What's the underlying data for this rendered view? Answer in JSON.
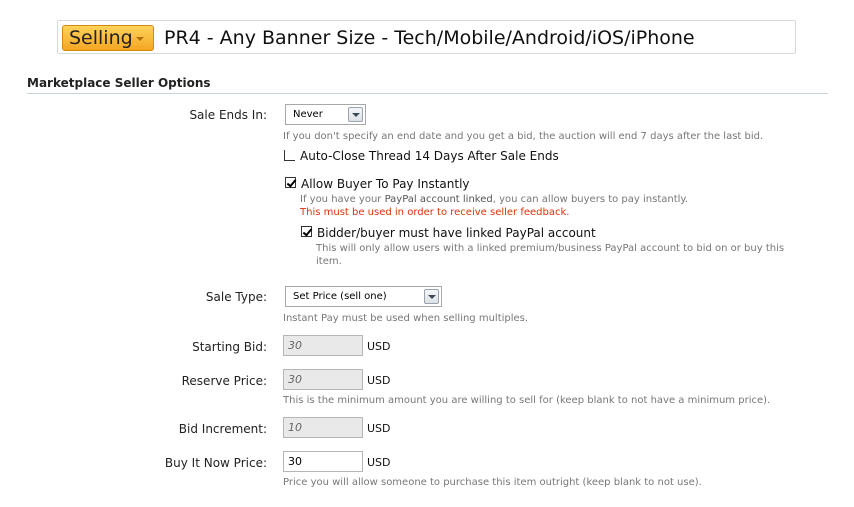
{
  "title_bar": {
    "prefix": "Selling",
    "thread_title": "PR4 - Any Banner Size - Tech/Mobile/Android/iOS/iPhone"
  },
  "section": {
    "heading": "Marketplace Seller Options"
  },
  "sale_ends": {
    "label": "Sale Ends In:",
    "value": "Never",
    "help": "If you don't specify an end date and you get a bid, the auction will end 7 days after the last bid."
  },
  "auto_close": {
    "label": "Auto-Close Thread 14 Days After Sale Ends",
    "checked": false
  },
  "instant_pay": {
    "label": "Allow Buyer To Pay Instantly",
    "checked": true,
    "help_pre": "If you have your ",
    "help_link": "PayPal account linked",
    "help_post": ", you can allow buyers to pay instantly.",
    "warning": "This must be used in order to receive seller feedback."
  },
  "linked_paypal": {
    "label": "Bidder/buyer must have linked PayPal account",
    "checked": true,
    "help_line1": "This will only allow users with a linked premium/business PayPal account to bid on or buy this",
    "help_line2": "item."
  },
  "sale_type": {
    "label": "Sale Type:",
    "value": "Set Price (sell one)",
    "help": "Instant Pay must be used when selling multiples."
  },
  "starting_bid": {
    "label": "Starting Bid:",
    "value": "30",
    "unit": "USD"
  },
  "reserve_price": {
    "label": "Reserve Price:",
    "value": "30",
    "unit": "USD",
    "help": "This is the minimum amount you are willing to sell for (keep blank to not have a minimum price)."
  },
  "bid_increment": {
    "label": "Bid Increment:",
    "value": "10",
    "unit": "USD"
  },
  "buy_it_now": {
    "label": "Buy It Now Price:",
    "value": "30",
    "unit": "USD",
    "help": "Price you will allow someone to purchase this item outright (keep blank to not use)."
  }
}
